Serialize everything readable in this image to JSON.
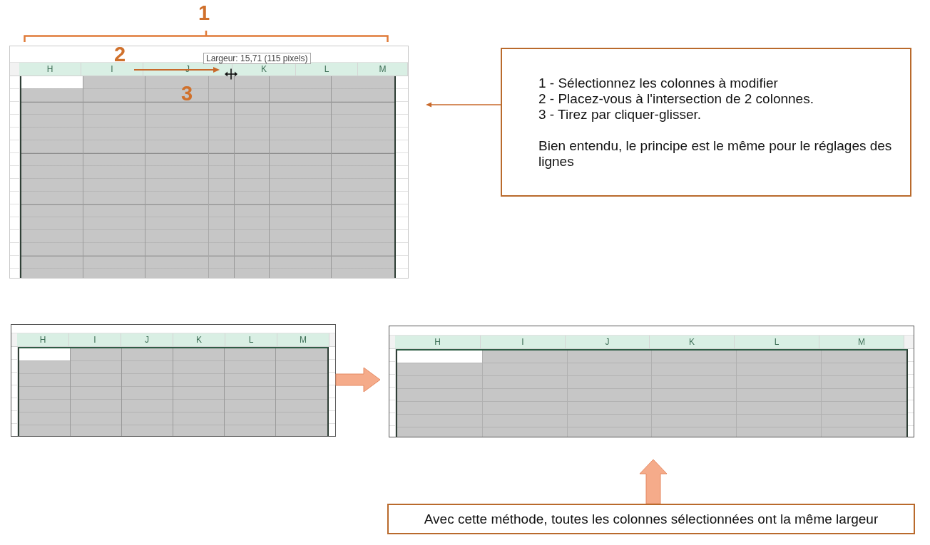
{
  "step_numbers": [
    "1",
    "2",
    "3"
  ],
  "top_sheet": {
    "tooltip": "Largeur: 15,71 (115 pixels)",
    "columns": [
      {
        "label": "H",
        "selected": true
      },
      {
        "label": "I",
        "selected": true
      },
      {
        "label": "J",
        "selected": true
      },
      {
        "label": "K",
        "selected": true
      },
      {
        "label": "L",
        "selected": true
      },
      {
        "label": "M",
        "selected": true
      }
    ]
  },
  "instructions": {
    "steps": [
      "1 - Sélectionnez les colonnes à modifier",
      "2 - Placez-vous à l'intersection de 2 colonnes.",
      "3 - Tirez par cliquer-glisser."
    ],
    "note": "Bien entendu, le principe est le même pour le réglages des lignes"
  },
  "before_sheet": {
    "columns": [
      {
        "label": "H",
        "selected": true
      },
      {
        "label": "I",
        "selected": true
      },
      {
        "label": "J",
        "selected": true
      },
      {
        "label": "K",
        "selected": true
      },
      {
        "label": "L",
        "selected": true
      },
      {
        "label": "M",
        "selected": true
      }
    ]
  },
  "after_sheet": {
    "columns": [
      {
        "label": "H",
        "selected": true
      },
      {
        "label": "I",
        "selected": true
      },
      {
        "label": "J",
        "selected": true
      },
      {
        "label": "K",
        "selected": true
      },
      {
        "label": "L",
        "selected": true
      },
      {
        "label": "M",
        "selected": true
      }
    ]
  },
  "conclusion": "Avec cette méthode, toutes les colonnes sélectionnées ont la même largeur"
}
